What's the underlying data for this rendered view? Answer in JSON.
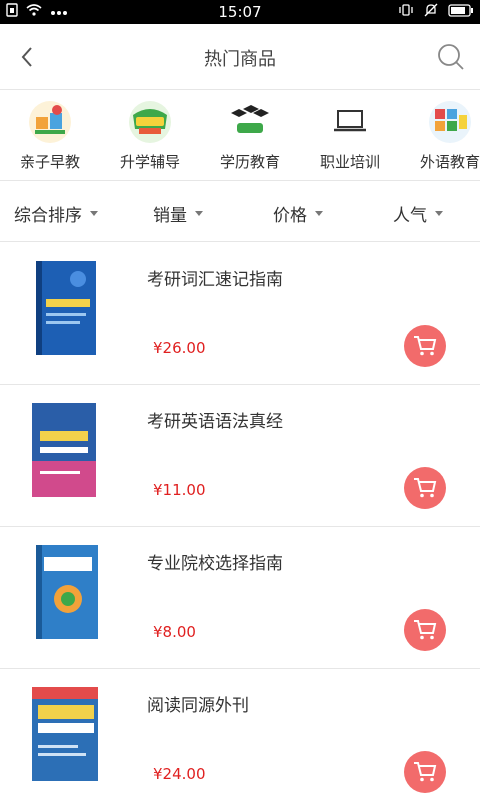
{
  "status_bar": {
    "time": "15:07"
  },
  "header": {
    "title": "热门商品"
  },
  "categories": [
    {
      "label": "亲子早教",
      "icon": "kids-education-icon",
      "color": "#f2a23a"
    },
    {
      "label": "升学辅导",
      "icon": "tutoring-icon",
      "color": "#3ea84a"
    },
    {
      "label": "学历教育",
      "icon": "graduation-cap-icon",
      "color": "#222222"
    },
    {
      "label": "职业培训",
      "icon": "laptop-icon",
      "color": "#333333"
    },
    {
      "label": "外语教育",
      "icon": "language-blocks-icon",
      "color": "#4aa3df"
    }
  ],
  "sort": {
    "comprehensive": "综合排序",
    "sales": "销量",
    "price": "价格",
    "popularity": "人气"
  },
  "products": [
    {
      "name": "考研词汇速记指南",
      "price": "¥26.00",
      "cover_color": "#1d5fb4"
    },
    {
      "name": "考研英语语法真经",
      "price": "¥11.00",
      "cover_color": "#2a5ea8"
    },
    {
      "name": "专业院校选择指南",
      "price": "¥8.00",
      "cover_color": "#2f7fc8"
    },
    {
      "name": "阅读同源外刊",
      "price": "¥24.00",
      "cover_color": "#2c6fb6"
    }
  ]
}
